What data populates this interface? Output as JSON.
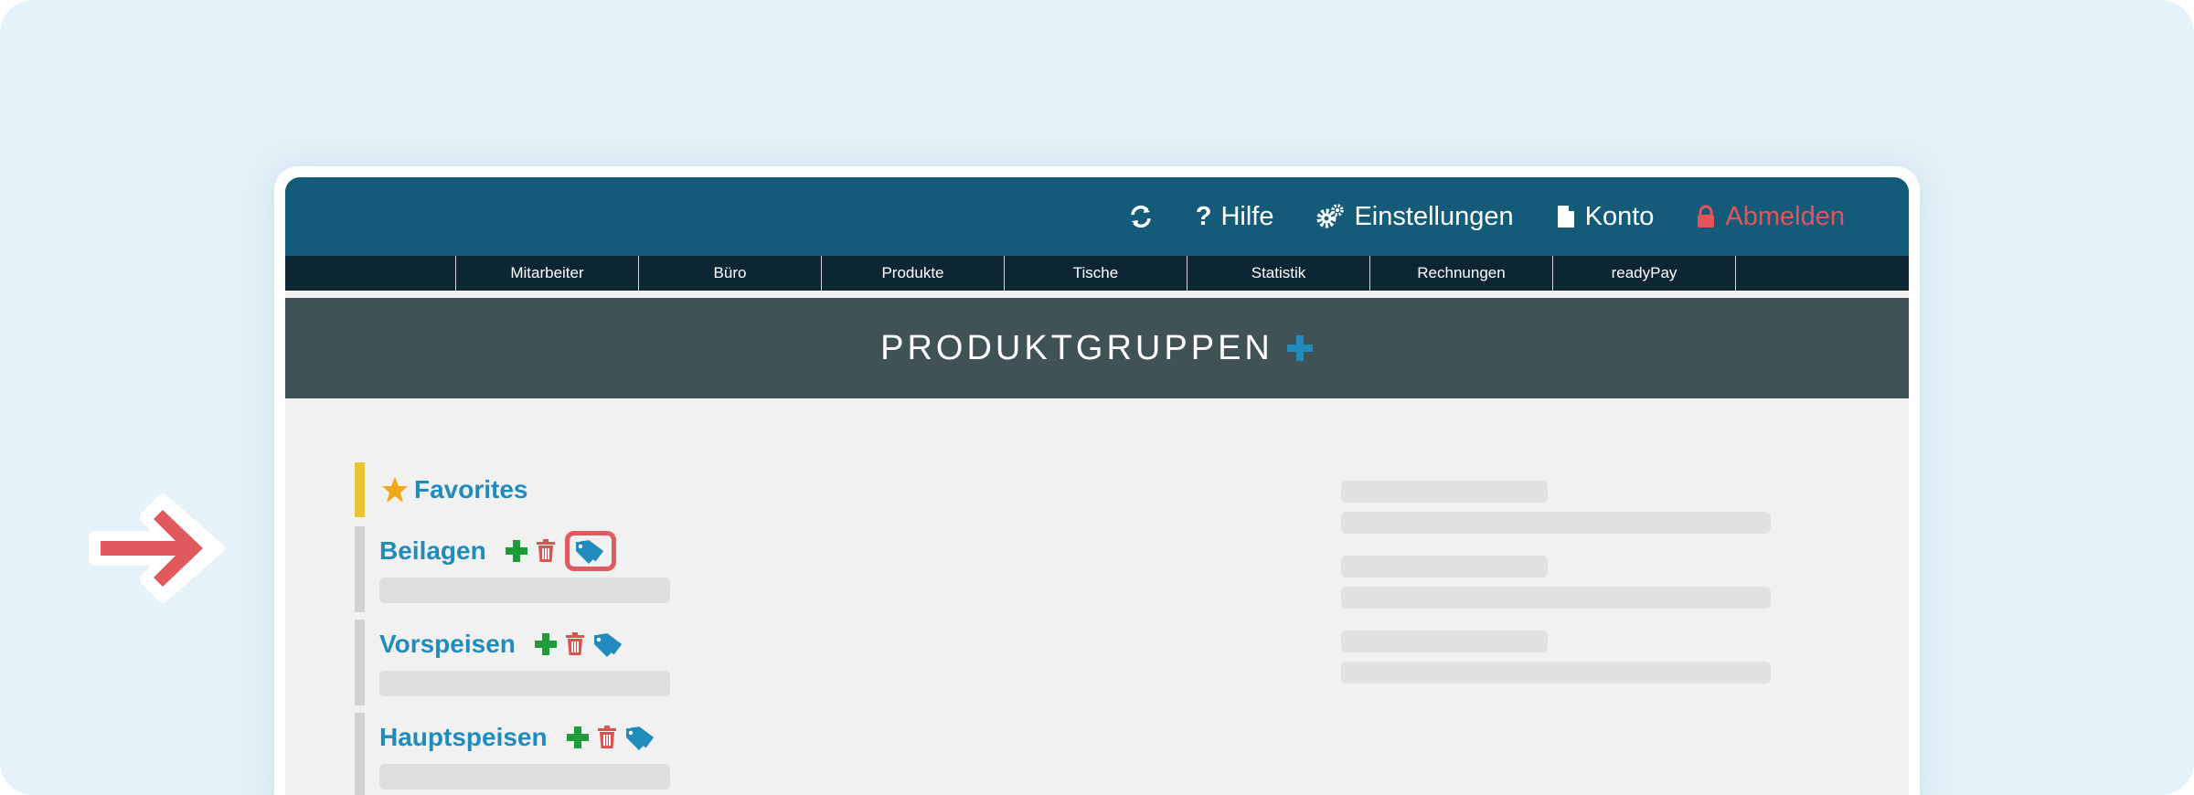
{
  "header": {
    "nav": {
      "help": "Hilfe",
      "settings": "Einstellungen",
      "account": "Konto",
      "logout": "Abmelden"
    }
  },
  "menu": {
    "items": [
      "Mitarbeiter",
      "Büro",
      "Produkte",
      "Tische",
      "Statistik",
      "Rechnungen",
      "readyPay"
    ]
  },
  "page": {
    "title": "PRODUKTGRUPPEN"
  },
  "favorites": {
    "label": "Favorites"
  },
  "groups": [
    {
      "name": "Beilagen"
    },
    {
      "name": "Vorspeisen"
    },
    {
      "name": "Hauptspeisen"
    }
  ],
  "colors": {
    "topbar": "#135b78",
    "menubar": "#0d2634",
    "title_band": "#415257",
    "link": "#1f8cbd",
    "add": "#1e9c3a",
    "delete": "#d9534f",
    "highlight": "#e05a5e",
    "favorite_bar": "#e8c42e"
  },
  "icons": [
    "refresh-icon",
    "question-icon",
    "gears-icon",
    "document-icon",
    "lock-icon",
    "star-icon",
    "plus-icon",
    "trash-icon",
    "tags-icon",
    "right-arrow-icon"
  ]
}
